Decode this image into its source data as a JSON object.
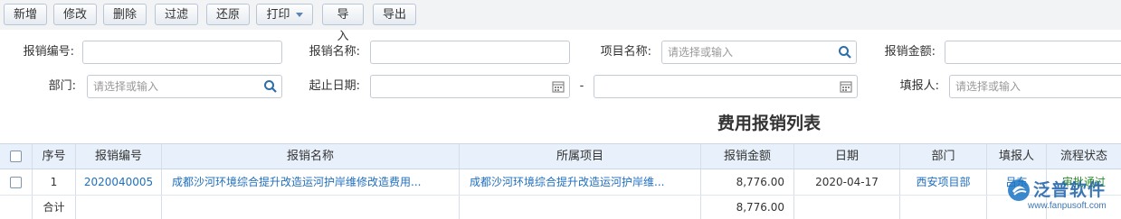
{
  "toolbar": {
    "buttons": [
      "新增",
      "修改",
      "删除",
      "过滤",
      "还原",
      "打印",
      "导入",
      "导出"
    ]
  },
  "filters": {
    "claim_no_label": "报销编号:",
    "claim_name_label": "报销名称:",
    "project_label": "项目名称:",
    "project_placeholder": "请选择或输入",
    "amount_label": "报销金额:",
    "dept_label": "部门:",
    "dept_placeholder": "请选择或输入",
    "date_label": "起止日期:",
    "date_sep": "-",
    "filler_label": "填报人:",
    "filler_placeholder": "请选择或输入"
  },
  "page_title": "费用报销列表",
  "table": {
    "headers": [
      "序号",
      "报销编号",
      "报销名称",
      "所属项目",
      "报销金额",
      "日期",
      "部门",
      "填报人",
      "流程状态"
    ],
    "rows": [
      {
        "index": "1",
        "claim_no": "2020040005",
        "claim_name": "成都沙河环境综合提升改造运河护岸维修改造费用...",
        "project": "成都沙河环境综合提升改造运河护岸维...",
        "amount": "8,776.00",
        "date": "2020-04-17",
        "dept": "西安项目部",
        "filler": "吕东",
        "status": "审批通过"
      }
    ],
    "total_label": "合计",
    "total_amount": "8,776.00"
  },
  "watermark": {
    "brand": "泛普软件",
    "url": "www.fanpusoft.com"
  },
  "colors": {
    "link": "#1f6fbf",
    "header_bg": "#e8f1fb",
    "status_green": "#2e8b2e"
  }
}
